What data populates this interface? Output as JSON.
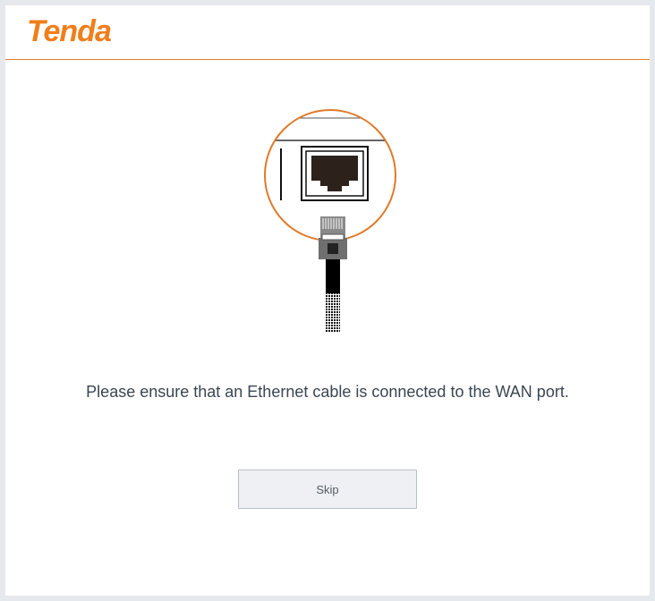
{
  "brand": {
    "logo_text": "Tenda",
    "accent_color": "#f07e1b"
  },
  "main": {
    "illustration_name": "ethernet-cable-wan-port-icon",
    "message": "Please ensure that an Ethernet cable is connected to the WAN port."
  },
  "actions": {
    "skip_label": "Skip"
  }
}
